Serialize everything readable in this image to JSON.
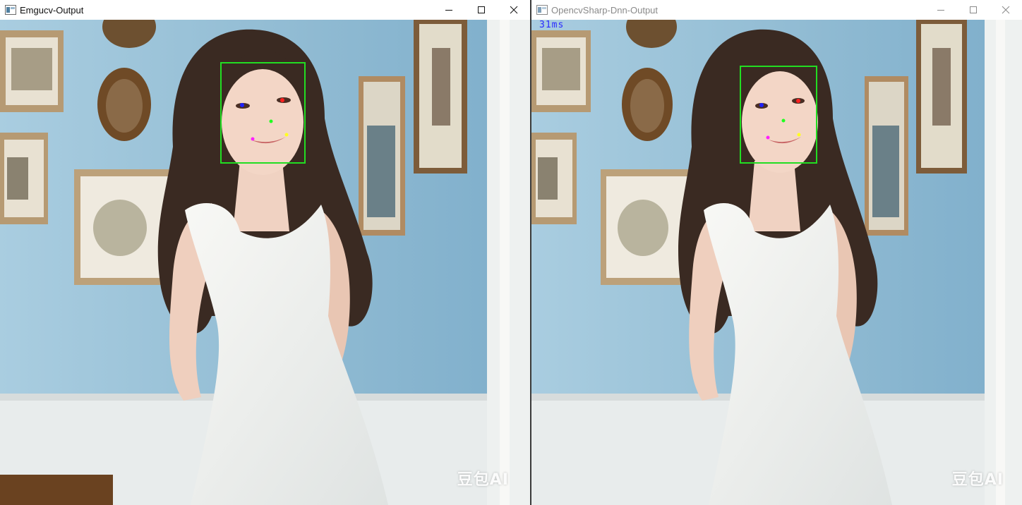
{
  "windows": {
    "left": {
      "title": "Emgucv-Output",
      "watermark": "豆包AI"
    },
    "right": {
      "title": "OpencvSharp-Dnn-Output",
      "fps": "31ms",
      "watermark": "豆包AI"
    }
  },
  "icons": {
    "app": "window-app-icon",
    "minimize": "minimize-icon",
    "maximize": "maximize-icon",
    "close": "close-icon"
  },
  "colors": {
    "face_box": "#22dd22",
    "landmark_right_eye": "#2020ff",
    "landmark_left_eye": "#ff2020",
    "landmark_nose": "#20ff20",
    "landmark_mouth_right": "#ff20ff",
    "landmark_mouth_left": "#ffff20",
    "wall": "#9fc4d8",
    "fps_text": "#2a2aff"
  }
}
